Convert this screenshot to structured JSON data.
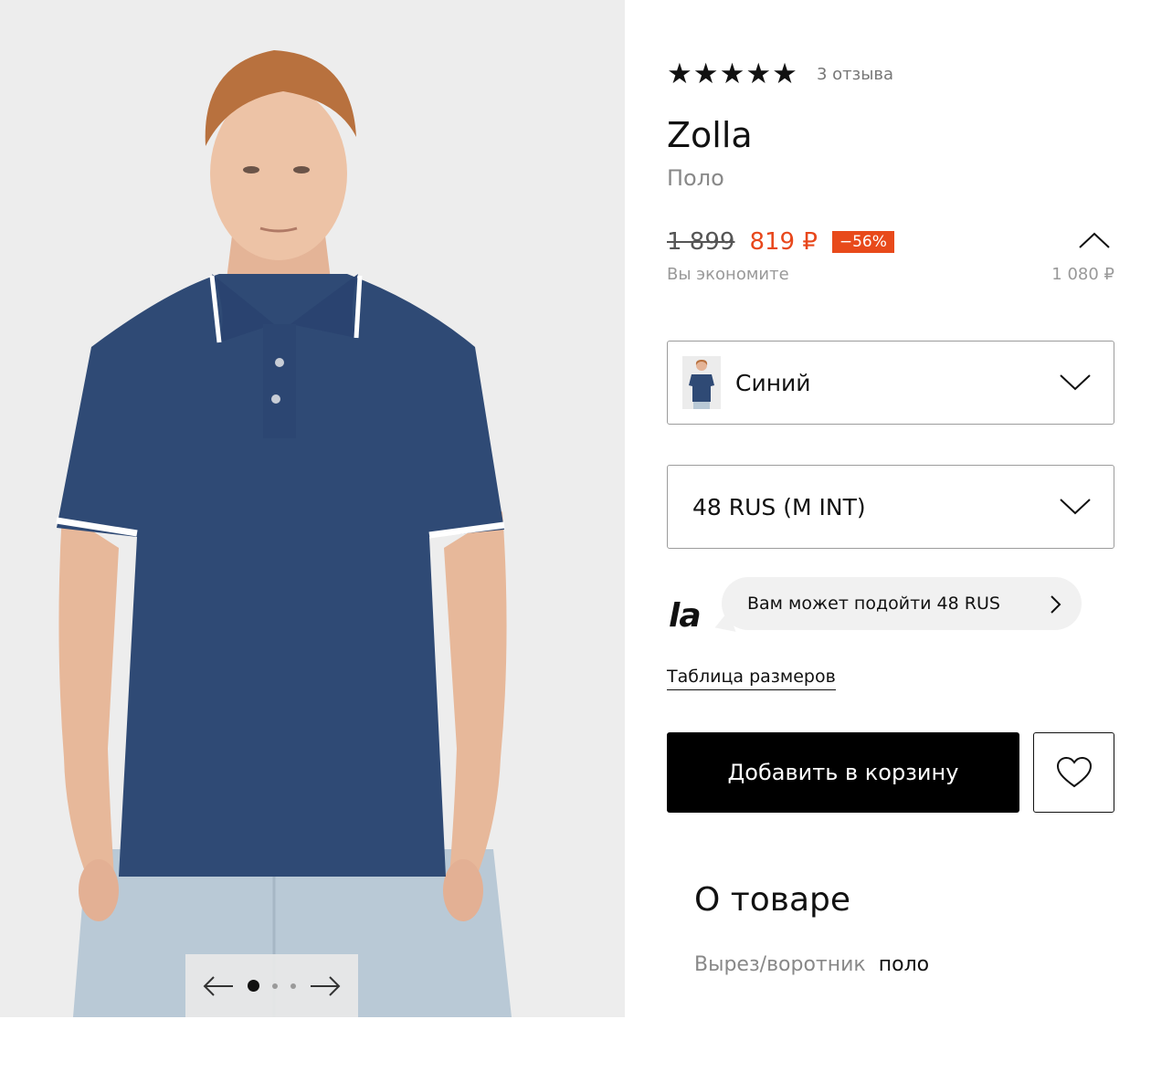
{
  "gallery": {
    "image_alt": "Мужчина в синем поло Zolla",
    "slides_count": 3,
    "active_slide": 1
  },
  "rating": {
    "stars": "★★★★★",
    "value": 5,
    "reviews": "3 отзыва"
  },
  "product": {
    "brand": "Zolla",
    "category": "Поло"
  },
  "price": {
    "old": "1 899",
    "new": "819 ₽",
    "discount": "−56%",
    "savings_label": "Вы экономите",
    "savings_value": "1 080 ₽"
  },
  "color_select": {
    "value": "Синий"
  },
  "size_select": {
    "value": "48 RUS (M INT)"
  },
  "fit": {
    "logo": "la",
    "suggestion": "Вам может подойти 48 RUS"
  },
  "size_table_link": "Таблица размеров",
  "actions": {
    "add_to_cart": "Добавить в корзину"
  },
  "about": {
    "title": "О товаре",
    "attributes": [
      {
        "label": "Вырез/воротник",
        "value": "поло"
      }
    ]
  },
  "colors": {
    "accent": "#e8471b",
    "shirt": "#2f4a75",
    "button": "#000000"
  }
}
